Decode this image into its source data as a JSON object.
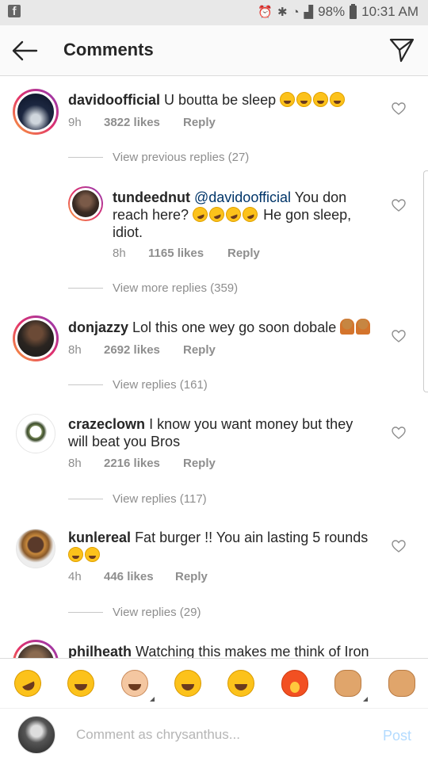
{
  "status_bar": {
    "battery": "98%",
    "time": "10:31 AM",
    "notification": "f"
  },
  "header": {
    "title": "Comments"
  },
  "comments": [
    {
      "username": "davidoofficial",
      "text": "U boutta be sleep",
      "time": "9h",
      "likes": "3822 likes",
      "reply": "Reply",
      "view_replies": "View previous replies (27)"
    },
    {
      "username": "tundeednut",
      "mention": "@davidoofficial",
      "text_before": "You don reach here?",
      "text_after": "He gon sleep, idiot.",
      "time": "8h",
      "likes": "1165 likes",
      "reply": "Reply",
      "view_replies": "View more replies (359)"
    },
    {
      "username": "donjazzy",
      "text": "Lol this one wey go soon dobale",
      "time": "8h",
      "likes": "2692 likes",
      "reply": "Reply",
      "view_replies": "View replies (161)"
    },
    {
      "username": "crazeclown",
      "text": "I know you want money but they will beat you Bros",
      "time": "8h",
      "likes": "2216 likes",
      "reply": "Reply",
      "view_replies": "View replies (117)"
    },
    {
      "username": "kunlereal",
      "text": "Fat burger !! You ain lasting 5 rounds",
      "time": "4h",
      "likes": "446 likes",
      "reply": "Reply",
      "view_replies": "View replies (29)"
    },
    {
      "username": "philheath",
      "text": "Watching this makes me think of Iron"
    }
  ],
  "input": {
    "placeholder": "Comment as chrysanthus...",
    "post_label": "Post"
  },
  "colors": {
    "link": "#003569",
    "muted": "#8e8e8e",
    "post_disabled": "#b3dbff"
  }
}
